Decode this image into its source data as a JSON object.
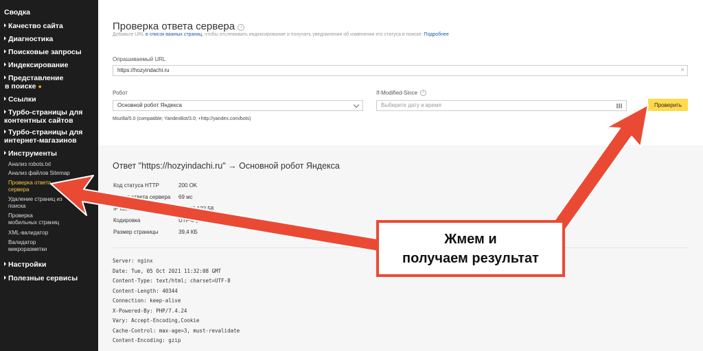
{
  "sidebar": {
    "items": [
      {
        "label": "Сводка"
      },
      {
        "label": "Качество сайта"
      },
      {
        "label": "Диагностика"
      },
      {
        "label": "Поисковые запросы"
      },
      {
        "label": "Индексирование"
      },
      {
        "label_line1": "Представление",
        "label_line2": "в поиске",
        "badge": "●"
      },
      {
        "label": "Ссылки"
      },
      {
        "label_line1": "Турбо-страницы для",
        "label_line2": "контентных сайтов"
      },
      {
        "label_line1": "Турбо-страницы для",
        "label_line2": "интернет-магазинов"
      },
      {
        "label": "Инструменты"
      },
      {
        "label": "Настройки"
      },
      {
        "label": "Полезные сервисы"
      }
    ],
    "tools_sub": [
      {
        "label": "Анализ robots.txt"
      },
      {
        "label": "Анализ файлов Sitemap"
      },
      {
        "label_line1": "Проверка ответа",
        "label_line2": "сервера"
      },
      {
        "label_line1": "Удаление страниц из",
        "label_line2": "поиска"
      },
      {
        "label_line1": "Проверка",
        "label_line2": "мобильных страниц"
      },
      {
        "label": "XML-валидатор"
      },
      {
        "label_line1": "Валидатор",
        "label_line2": "микроразметки"
      }
    ]
  },
  "page": {
    "title": "Проверка ответа сервера",
    "info_glyph": "i",
    "subtitle_pre": "Добавьте URL ",
    "subtitle_link": "в список важных страниц",
    "subtitle_mid": ", чтобы отслеживать индексирование и получать уведомления об изменении его статуса в поиске. ",
    "subtitle_more": "Подробнее"
  },
  "form": {
    "url_label": "Опрашиваемый URL",
    "url_value": "https://hozyindachi.ru",
    "clear_glyph": "×",
    "robot_label": "Робот",
    "robot_value": "Основной робот Яндекса",
    "ims_label": "If-Modified-Since",
    "ims_placeholder": "Выберите дату и время",
    "check_button": "Проверить",
    "user_agent": "Mozilla/5.0 (compatible; YandexBot/3.0; +http://yandex.com/bots)"
  },
  "response": {
    "title": "Ответ \"https://hozyindachi.ru\" → Основной робот Яндекса",
    "rows": [
      {
        "key": "Код статуса HTTP",
        "value": "200 OK"
      },
      {
        "key": "Время ответа сервера",
        "value": "69 мс"
      },
      {
        "key": "IP сайта",
        "value": "185.26.122.58"
      },
      {
        "key": "Кодировка",
        "value": "UTF-8 (ISO-8859-1-utf-8, UTF8)"
      },
      {
        "key": "Размер страницы",
        "value": "39,4 КБ"
      }
    ],
    "headers": [
      "Server: nginx",
      "Date: Tue, 05 Oct 2021 11:32:08 GMT",
      "Content-Type: text/html; charset=UTF-8",
      "Content-Length: 40344",
      "Connection: keep-alive",
      "X-Powered-By: PHP/7.4.24",
      "Vary: Accept-Encoding,Cookie",
      "Cache-Control: max-age=3, must-revalidate",
      "Content-Encoding: gzip"
    ]
  },
  "annotation": {
    "line1": "Жмем и",
    "line2": "получаем результат",
    "arrow_color": "#ea4a34"
  }
}
